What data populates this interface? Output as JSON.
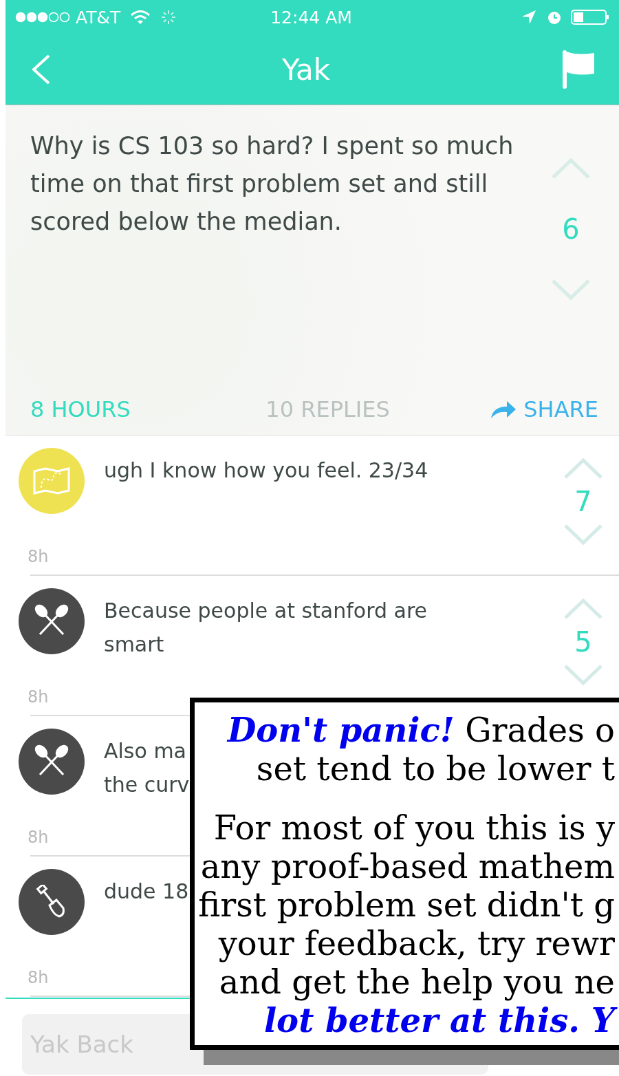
{
  "status_bar": {
    "carrier": "AT&T",
    "time": "12:44 AM"
  },
  "nav": {
    "title": "Yak"
  },
  "post": {
    "text": "Why is CS 103 so hard?  I spent so much time on that first problem set and still scored below the median.",
    "votes": "6",
    "age": "8 HOURS",
    "replies": "10 REPLIES",
    "share": "SHARE"
  },
  "replies": [
    {
      "lines": [
        "ugh I know how you feel. 23/34"
      ],
      "time": "8h",
      "votes": "7",
      "avatar": {
        "kind": "map",
        "color": "#efe252"
      }
    },
    {
      "lines": [
        "Because people at stanford are",
        "smart"
      ],
      "time": "8h",
      "votes": "5",
      "avatar": {
        "kind": "paddles",
        "color": "#4a4a4a"
      }
    },
    {
      "lines": [
        "Also ma",
        "the curv"
      ],
      "time": "8h",
      "avatar": {
        "kind": "paddles",
        "color": "#4a4a4a"
      }
    },
    {
      "lines": [
        "dude 18"
      ],
      "time": "8h",
      "avatar": {
        "kind": "shovel",
        "color": "#4a4a4a"
      }
    }
  ],
  "composer": {
    "placeholder": "Yak Back"
  },
  "callout": {
    "paragraphs": [
      [
        [
          {
            "text": "Don't panic!",
            "emphasis": true
          },
          {
            "text": " Grades o",
            "emphasis": false
          }
        ],
        [
          {
            "text": "set tend to be lower t",
            "emphasis": false
          }
        ]
      ],
      [
        [
          {
            "text": "For most of you this is y",
            "emphasis": false
          }
        ],
        [
          {
            "text": "any proof-based mathem",
            "emphasis": false
          }
        ],
        [
          {
            "text": "first problem set didn't g",
            "emphasis": false
          }
        ],
        [
          {
            "text": "your feedback, try rewr",
            "emphasis": false
          }
        ],
        [
          {
            "text": "and get the help you ne",
            "emphasis": false
          }
        ],
        [
          {
            "text": "lot better at this. Y",
            "emphasis": true
          }
        ]
      ]
    ]
  }
}
